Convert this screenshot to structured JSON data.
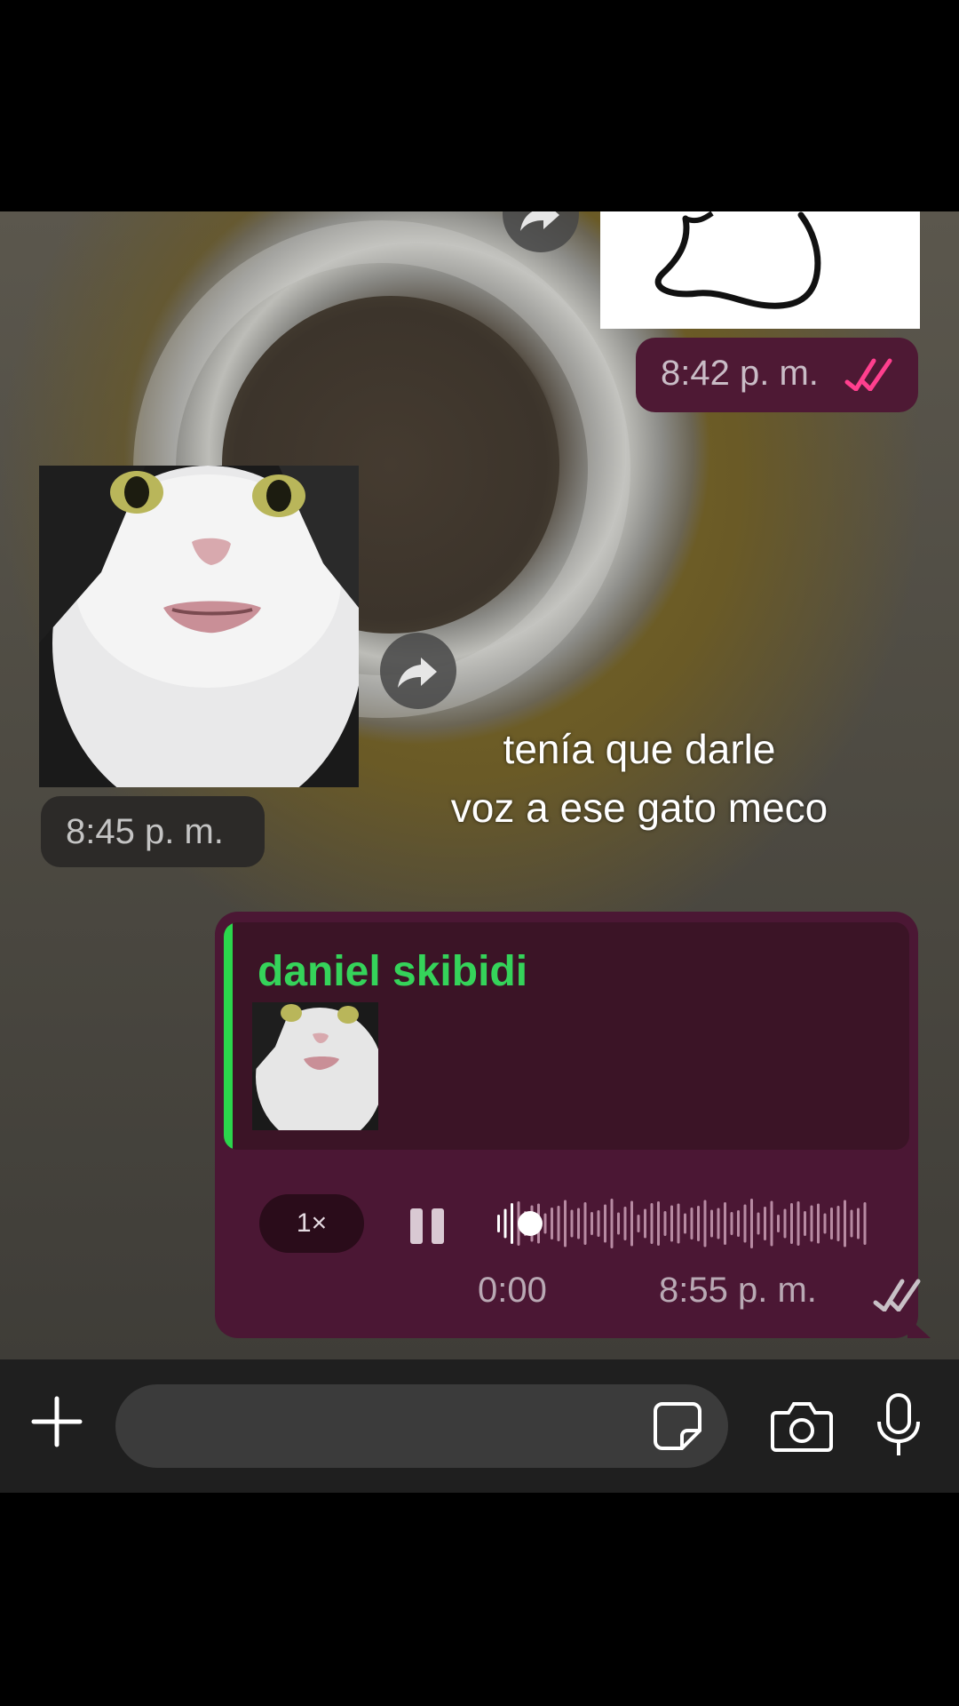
{
  "chat": {
    "out_sticker_time": "8:42 p. m.",
    "in_image_time": "8:45 p. m.",
    "caption_line1": "tenía que darle",
    "caption_line2": "voz a ese gato meco",
    "voice_message": {
      "reply_name": "daniel skibidi",
      "speed": "1×",
      "current_time": "0:00",
      "time": "8:55 p. m.",
      "progress": 0.05
    }
  },
  "input_bar": {
    "placeholder": ""
  },
  "colors": {
    "read_ticks": "#ff3f8e",
    "delivered_ticks": "#c8c0c6",
    "reply_accent": "#2bd64c",
    "outgoing_bubble": "#4b1734"
  }
}
